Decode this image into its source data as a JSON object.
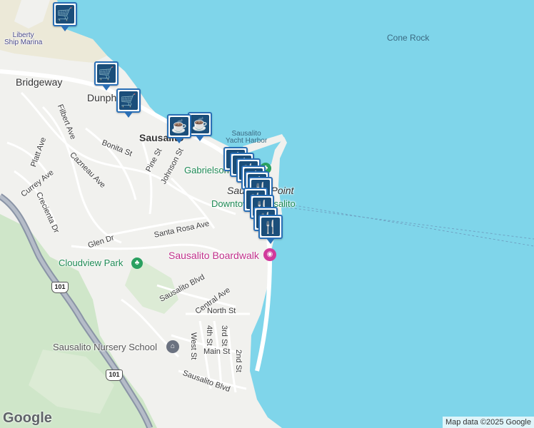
{
  "map": {
    "colors": {
      "water": "#7fd5ea",
      "land": "#f1f1ee",
      "park": "#cfe6c9",
      "highway": "#8a94a6",
      "road": "#ffffff"
    },
    "labels": {
      "liberty_ship_marina": "Liberty\nShip Marina",
      "bridgeway": "Bridgeway",
      "dunphy": "Dunphy",
      "cone_rock": "Cone Rock",
      "sausalito": "Sausalito",
      "yacht_harbor": "Sausalito\nYacht Harbor",
      "gabrielson": "Gabrielson",
      "sausalito_point": "Sausalito Point",
      "downtown": "Downtown Sausalito",
      "filbert_ave": "Filbert Ave",
      "bonita_st": "Bonita St",
      "pine_st": "Pine St",
      "johnson_st": "Johnson St",
      "platt_ave": "Platt Ave",
      "cazneau_ave": "Cazneau Ave",
      "currey_ave": "Currey Ave",
      "crecienta_dr": "Crecienta Dr",
      "santa_rosa_ave": "Santa Rosa Ave",
      "glen_dr": "Glen Dr",
      "cloudview_park": "Cloudview Park",
      "boardwalk": "Sausalito Boardwalk",
      "sausalito_blvd_1": "Sausalito Blvd",
      "central_ave": "Central Ave",
      "north_st": "North St",
      "fourth_st": "4th St",
      "third_st": "3rd St",
      "west_st": "West St",
      "main_st": "Main St",
      "second_st": "2nd St",
      "nursery_school": "Sausalito Nursery School",
      "sausalito_blvd_2": "Sausalito Blvd",
      "route_101": "101"
    },
    "markers": {
      "shopping": [
        "shopping-cart-icon",
        "shopping-cart-icon",
        "shopping-cart-icon"
      ],
      "cafe": [
        "coffee-cup-icon",
        "coffee-cup-icon"
      ],
      "restaurant": [
        "fork-knife-icon"
      ]
    },
    "logo": "Google",
    "attribution": "Map data ©2025 Google"
  }
}
